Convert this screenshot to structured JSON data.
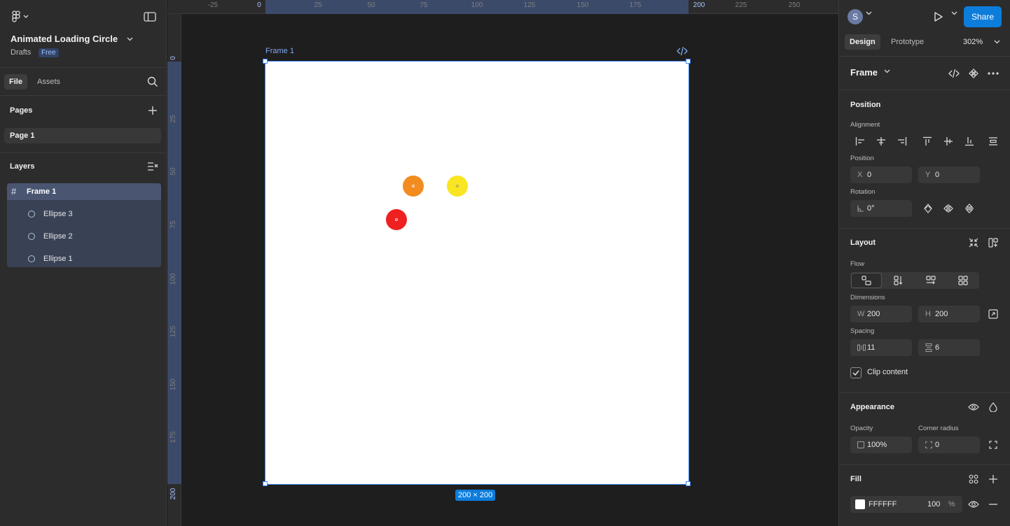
{
  "app": {
    "file_name": "Animated Loading Circle",
    "location": "Drafts",
    "plan_badge": "Free"
  },
  "left_tabs": {
    "file": "File",
    "assets": "Assets"
  },
  "pages": {
    "title": "Pages",
    "items": [
      "Page 1"
    ]
  },
  "layers": {
    "title": "Layers",
    "items": [
      {
        "label": "Frame 1",
        "icon": "frame-icon"
      },
      {
        "label": "Ellipse 3",
        "icon": "ellipse-icon"
      },
      {
        "label": "Ellipse 2",
        "icon": "ellipse-icon"
      },
      {
        "label": "Ellipse 1",
        "icon": "ellipse-icon"
      }
    ]
  },
  "rulers": {
    "x_ticks": [
      "-25",
      "0",
      "25",
      "50",
      "75",
      "100",
      "125",
      "150",
      "175",
      "200",
      "225",
      "250"
    ],
    "y_ticks": [
      "0",
      "25",
      "50",
      "75",
      "100",
      "125",
      "150",
      "175",
      "200"
    ]
  },
  "canvas": {
    "frame_label": "Frame 1",
    "size_badge": "200 × 200",
    "frame_color": "#FFFFFF",
    "ellipses": [
      {
        "name": "Ellipse 3",
        "color": "#F28B20"
      },
      {
        "name": "Ellipse 2",
        "color": "#FAE522"
      },
      {
        "name": "Ellipse 1",
        "color": "#EF2020"
      }
    ]
  },
  "right_header": {
    "avatar_initial": "S",
    "share_label": "Share",
    "tab_design": "Design",
    "tab_prototype": "Prototype",
    "zoom": "302%"
  },
  "design": {
    "frame_type": "Frame",
    "position": {
      "title": "Position",
      "alignment_label": "Alignment",
      "position_label": "Position",
      "x_prefix": "X",
      "x": "0",
      "y_prefix": "Y",
      "y": "0",
      "rotation_label": "Rotation",
      "rotation": "0°"
    },
    "layout": {
      "title": "Layout",
      "flow_label": "Flow",
      "dimensions_label": "Dimensions",
      "w_prefix": "W",
      "w": "200",
      "h_prefix": "H",
      "h": "200",
      "spacing_label": "Spacing",
      "gap_h": "11",
      "gap_v": "6",
      "clip_content_label": "Clip content",
      "clip_content": true
    },
    "appearance": {
      "title": "Appearance",
      "opacity_label": "Opacity",
      "opacity": "100%",
      "radius_label": "Corner radius",
      "radius": "0"
    },
    "fill": {
      "title": "Fill",
      "hex": "FFFFFF",
      "opacity": "100",
      "pct": "%"
    }
  },
  "colors": {
    "accent": "#0D7DDC",
    "selection": "#3A84FF"
  }
}
